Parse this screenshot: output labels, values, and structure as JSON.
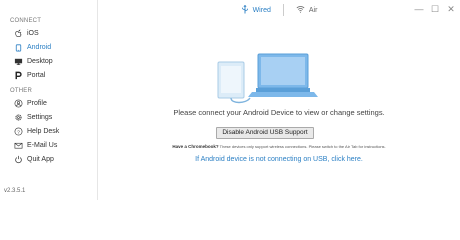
{
  "topbar": {
    "tabs": [
      {
        "label": "Wired",
        "icon": "usb-icon",
        "active": true
      },
      {
        "label": "Air",
        "icon": "wifi-icon",
        "active": false
      }
    ]
  },
  "window_controls": {
    "minimize": "—",
    "maximize": "☐",
    "close": "✕"
  },
  "sidebar": {
    "connect_title": "CONNECT",
    "connect_items": [
      {
        "label": "iOS",
        "icon": "apple-icon"
      },
      {
        "label": "Android",
        "icon": "android-icon",
        "active": true
      },
      {
        "label": "Desktop",
        "icon": "monitor-icon"
      },
      {
        "label": "Portal",
        "icon": "portal-icon"
      }
    ],
    "other_title": "OTHER",
    "other_items": [
      {
        "label": "Profile",
        "icon": "profile-icon"
      },
      {
        "label": "Settings",
        "icon": "gear-icon"
      },
      {
        "label": "Help Desk",
        "icon": "help-icon"
      },
      {
        "label": "E-Mail Us",
        "icon": "mail-icon"
      },
      {
        "label": "Quit App",
        "icon": "power-icon"
      }
    ],
    "version": "v2.3.5.1"
  },
  "main": {
    "message": "Please connect your Android Device to view or change settings.",
    "button_label": "Disable Android USB Support",
    "note_bold": "Have a Chromebook?",
    "note_text": " These devices only support wireless connections. Please switch to the Air Tab for instructions.",
    "help_link": "If Android device is not connecting on USB, click here.",
    "accent_color": "#2a7fc4"
  }
}
